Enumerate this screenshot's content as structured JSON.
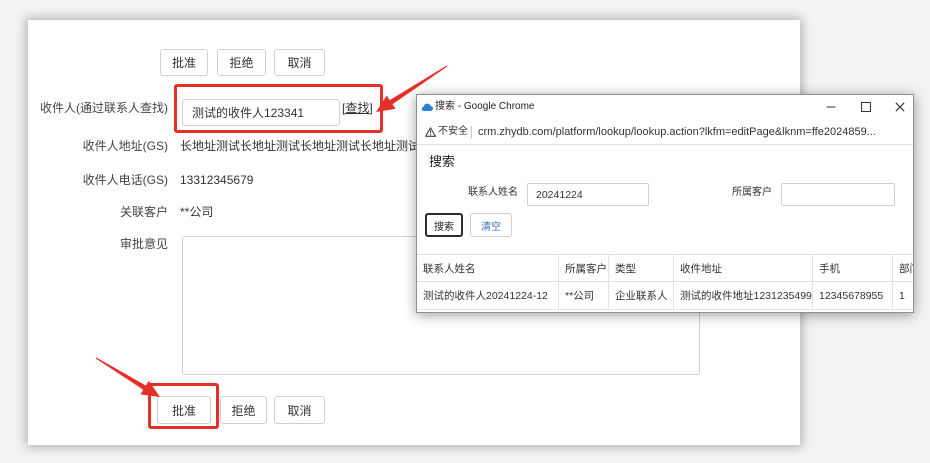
{
  "form": {
    "top_buttons": [
      {
        "label": "批准"
      },
      {
        "label": "拒绝"
      },
      {
        "label": "取消"
      }
    ],
    "recipient": {
      "label": "收件人(通过联系人查找)",
      "value": "测试的收件人123341",
      "lookup_link": "[查找]"
    },
    "address": {
      "label": "收件人地址(GS)",
      "value": "长地址测试长地址测试长地址测试长地址测试"
    },
    "phone": {
      "label": "收件人电话(GS)",
      "value": "13312345679"
    },
    "customer": {
      "label": "关联客户",
      "value": "**公司"
    },
    "comment": {
      "label": "审批意见"
    },
    "bottom_buttons": [
      {
        "label": "批准"
      },
      {
        "label": "拒绝"
      },
      {
        "label": "取消"
      }
    ]
  },
  "popup": {
    "window_title": "搜索 - Google Chrome",
    "icons": {
      "app": "cloud-icon",
      "security": "warning-icon",
      "minimize": "minimize-icon",
      "maximize": "maximize-icon",
      "close": "close-icon"
    },
    "address_bar": {
      "security_label": "不安全",
      "url": "crm.zhydb.com/platform/lookup/lookup.action?lkfm=editPage&lknm=ffe2024859..."
    },
    "heading": "搜索",
    "filters": [
      {
        "label": "联系人姓名",
        "value": "20241224"
      },
      {
        "label": "所属客户",
        "value": ""
      }
    ],
    "buttons": {
      "search": "搜索",
      "clear": "清空"
    },
    "table": {
      "columns": [
        "联系人姓名",
        "所属客户",
        "类型",
        "收件地址",
        "手机",
        "部门"
      ],
      "rows": [
        [
          "测试的收件人20241224-12",
          "**公司",
          "企业联系人",
          "测试的收件地址1231235499",
          "12345678955",
          "1"
        ]
      ]
    }
  },
  "colors": {
    "annotation_red": "#e5302a",
    "clear_button_text": "#3d6fb8",
    "app_icon_blue": "#2f7fd6"
  }
}
